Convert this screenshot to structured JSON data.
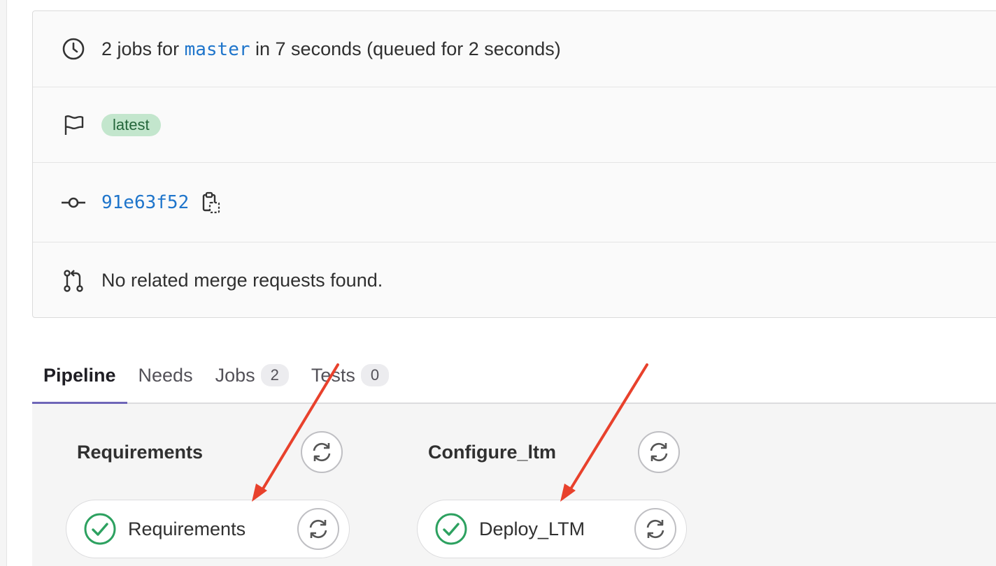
{
  "info": {
    "duration_prefix": "2 jobs for",
    "branch": "master",
    "duration_suffix": "in 7 seconds (queued for 2 seconds)",
    "badge": "latest",
    "commit_sha": "91e63f52",
    "merge_requests_text": "No related merge requests found."
  },
  "tabs": [
    {
      "label": "Pipeline",
      "active": true
    },
    {
      "label": "Needs"
    },
    {
      "label": "Jobs",
      "count": "2"
    },
    {
      "label": "Tests",
      "count": "0"
    }
  ],
  "stages": [
    {
      "title": "Requirements",
      "job": {
        "name": "Requirements",
        "status": "passed"
      }
    },
    {
      "title": "Configure_ltm",
      "job": {
        "name": "Deploy_LTM",
        "status": "passed"
      }
    }
  ],
  "colors": {
    "link": "#1f75cb",
    "success": "#2da160",
    "tab_active_underline": "#6e66b8",
    "annotation_arrow": "#e8412c"
  },
  "icons": {
    "duration": "clock-icon",
    "badge": "flag-icon",
    "commit": "commit-icon",
    "merge_request": "merge-request-icon",
    "copy": "copy-to-clipboard-icon",
    "retry": "retry-icon",
    "status": "status-success-icon"
  }
}
